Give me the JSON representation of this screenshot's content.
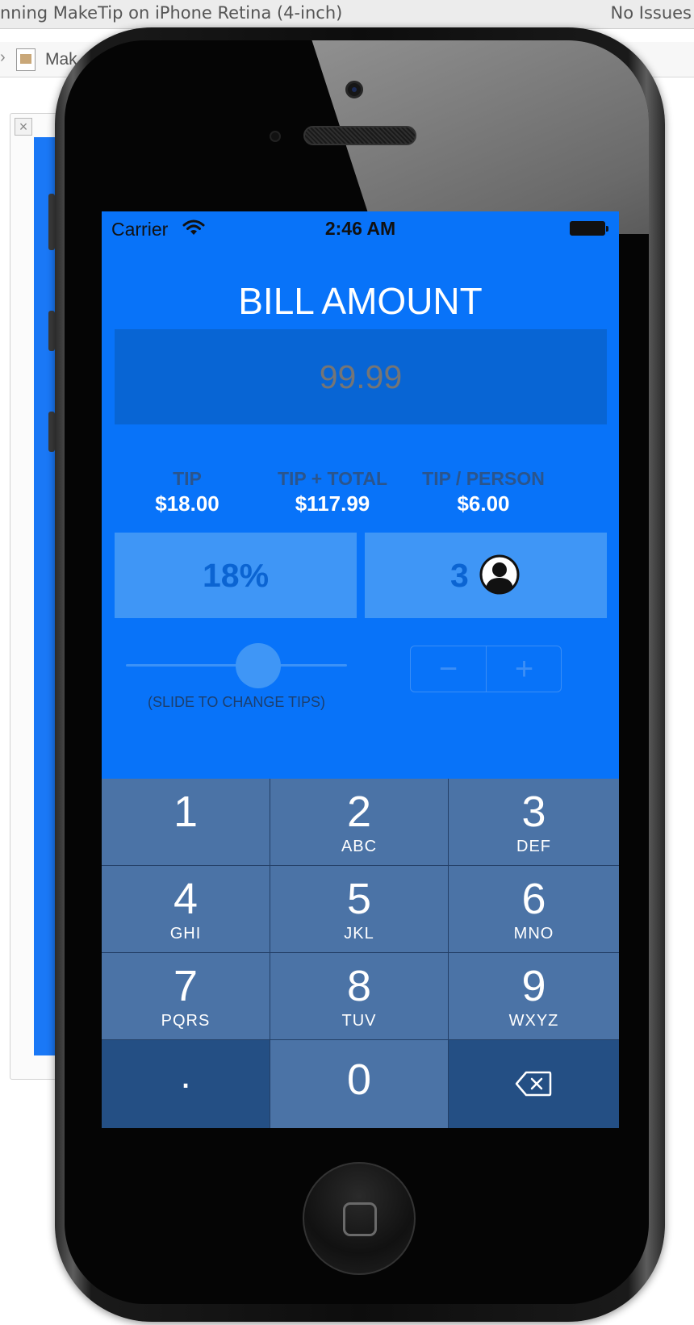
{
  "xcode": {
    "toolbar_title": "nning MakeTip on iPhone Retina (4-inch)",
    "status": "No Issues",
    "file_label": "Mak"
  },
  "status_bar": {
    "carrier": "Carrier",
    "time": "2:46 AM"
  },
  "bill": {
    "title": "BILL AMOUNT",
    "value": "99.99"
  },
  "summary": [
    {
      "label": "TIP",
      "value": "$18.00"
    },
    {
      "label": "TIP + TOTAL",
      "value": "$117.99"
    },
    {
      "label": "TIP / PERSON",
      "value": "$6.00"
    }
  ],
  "tip_percent": "18%",
  "people_count": "3",
  "slider": {
    "caption": "(SLIDE TO CHANGE TIPS)",
    "value_fraction": 0.6
  },
  "stepper": {
    "minus": "−",
    "plus": "+"
  },
  "keypad": {
    "keys": [
      {
        "digit": "1",
        "letters": ""
      },
      {
        "digit": "2",
        "letters": "ABC"
      },
      {
        "digit": "3",
        "letters": "DEF"
      },
      {
        "digit": "4",
        "letters": "GHI"
      },
      {
        "digit": "5",
        "letters": "JKL"
      },
      {
        "digit": "6",
        "letters": "MNO"
      },
      {
        "digit": "7",
        "letters": "PQRS"
      },
      {
        "digit": "8",
        "letters": "TUV"
      },
      {
        "digit": "9",
        "letters": "WXYZ"
      }
    ],
    "dot": ".",
    "zero": "0",
    "delete_icon": "backspace-icon"
  },
  "colors": {
    "screen_background": "#0873f9",
    "field_background": "#0865d4",
    "tile_background": "#3f96f6",
    "key_background": "#4b73a6",
    "key_dark_background": "#244f84"
  }
}
